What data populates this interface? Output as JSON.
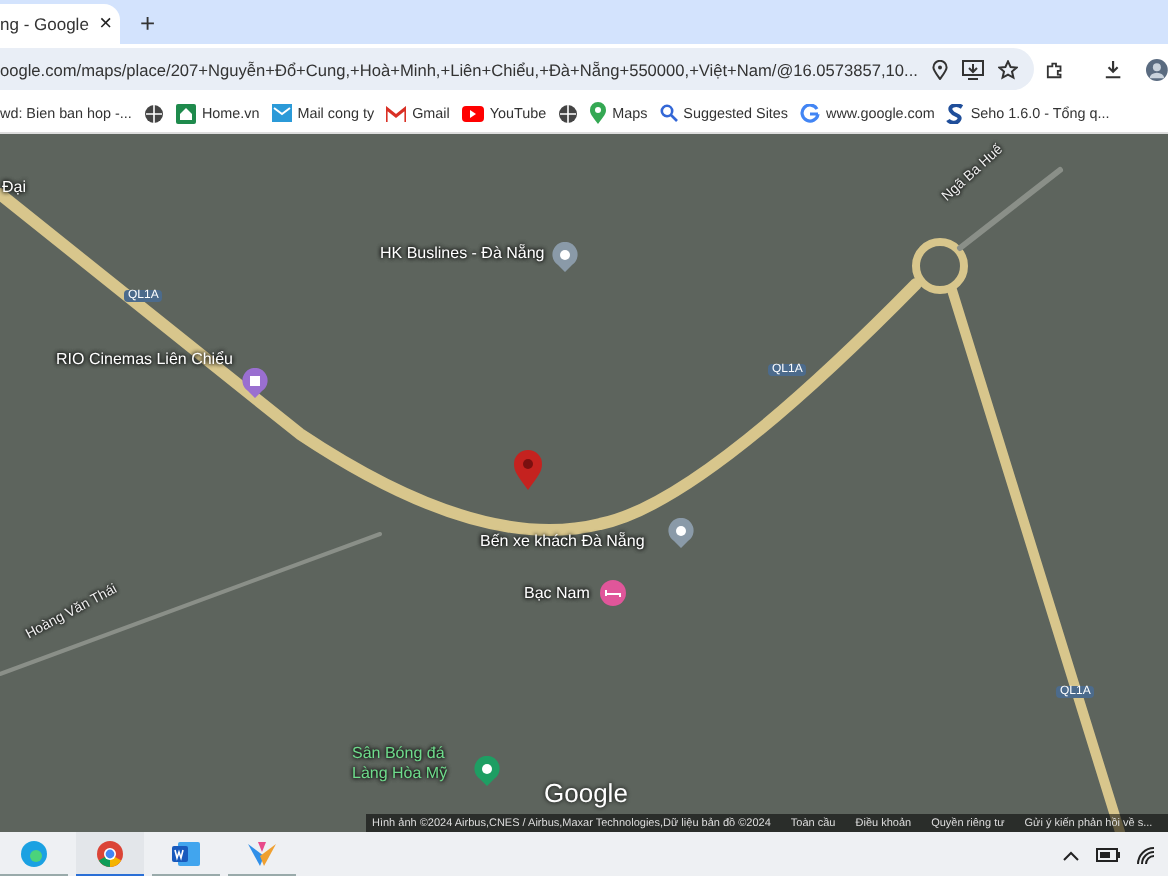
{
  "browser": {
    "tab": {
      "title": "ng - Google",
      "close": "×"
    },
    "new_tab": "+",
    "address": "oogle.com/maps/place/207+Nguyễn+Đổ+Cung,+Hoà+Minh,+Liên+Chiểu,+Đà+Nẵng+550000,+Việt+Nam/@16.0573857,10...",
    "bookmarks": [
      {
        "kind": "none",
        "label": "wd: Bien ban hop -..."
      },
      {
        "kind": "globe"
      },
      {
        "kind": "home",
        "label": "Home.vn"
      },
      {
        "kind": "mail",
        "label": "Mail cong ty"
      },
      {
        "kind": "gmail",
        "label": "Gmail"
      },
      {
        "kind": "youtube",
        "label": "YouTube"
      },
      {
        "kind": "globe"
      },
      {
        "kind": "maps",
        "label": "Maps"
      },
      {
        "kind": "search",
        "label": "Suggested Sites"
      },
      {
        "kind": "google",
        "label": "www.google.com"
      },
      {
        "kind": "seho",
        "label": "Seho 1.6.0 - Tổng q..."
      }
    ]
  },
  "map": {
    "labels": [
      {
        "kind": "place",
        "text": "Đại"
      },
      {
        "kind": "place",
        "text": "HK Buslines - Đà Nẵng"
      },
      {
        "kind": "place",
        "text": "RIO Cinemas Liên Chiểu"
      },
      {
        "kind": "place",
        "text": "Bến xe khách Đà Nẵng"
      },
      {
        "kind": "place",
        "text": "Bạc Nam"
      },
      {
        "kind": "park",
        "text": "Sân Bóng đá Làng Hòa Mỹ"
      },
      {
        "kind": "road",
        "text": "Ngã Ba Huế"
      },
      {
        "kind": "road",
        "text": "Hoàng Văn Thái"
      },
      {
        "kind": "shield",
        "text": "QL1A"
      },
      {
        "kind": "shield",
        "text": "QL1A"
      },
      {
        "kind": "shield",
        "text": "QL1A"
      }
    ],
    "logo": "Google",
    "footer": [
      "Hình ảnh ©2024 Airbus,CNES / Airbus,Maxar Technologies,Dữ liệu bản đồ ©2024",
      "Toàn cầu",
      "Điều khoản",
      "Quyền riêng tư",
      "Gửi ý kiến phản hồi về s..."
    ]
  },
  "taskbar": {
    "apps": [
      {
        "kind": "edge",
        "selected": false
      },
      {
        "kind": "chrome",
        "selected": true
      },
      {
        "kind": "word",
        "selected": false
      },
      {
        "kind": "copilot",
        "selected": false
      }
    ]
  }
}
